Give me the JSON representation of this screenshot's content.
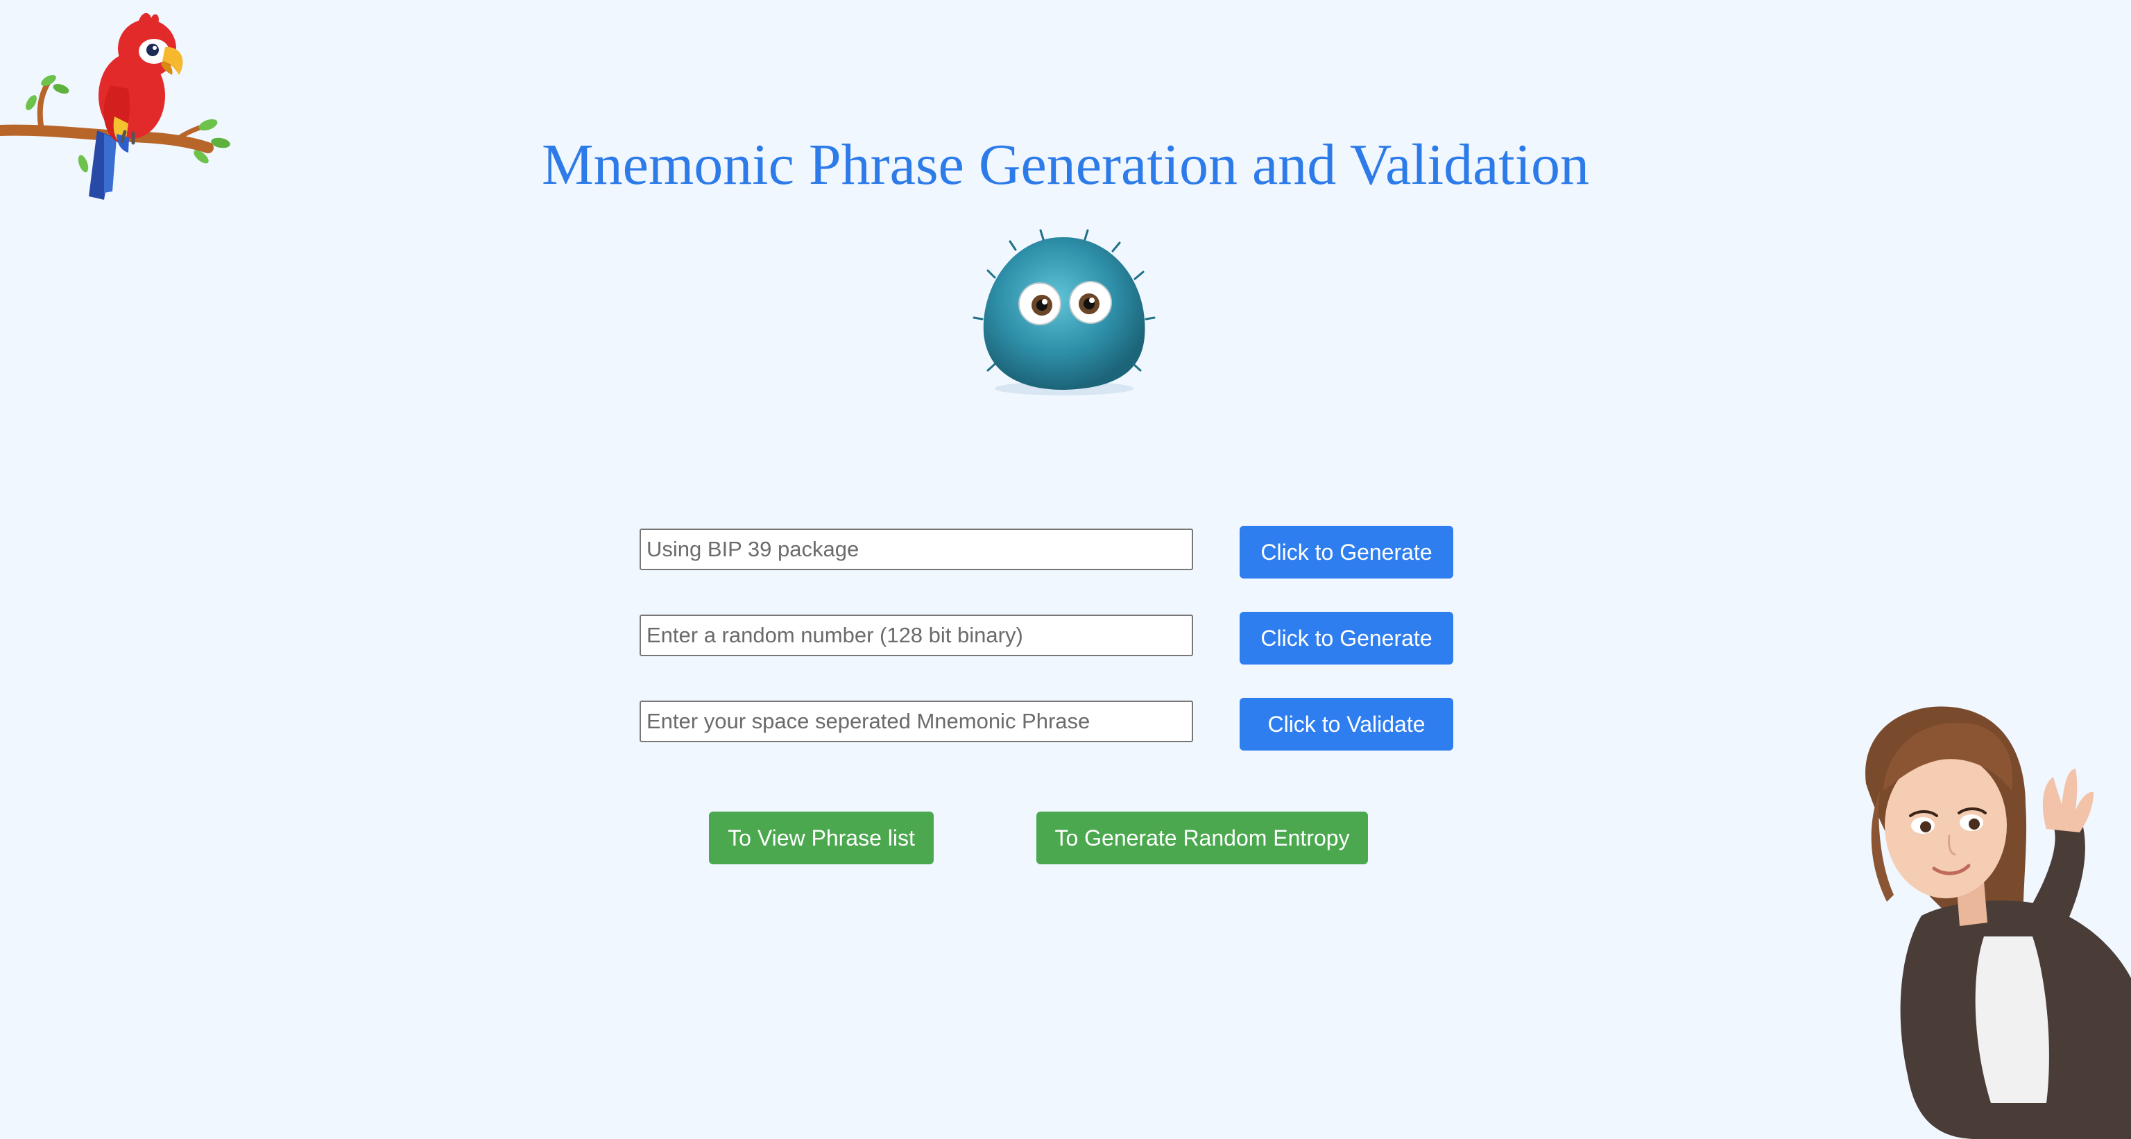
{
  "page": {
    "title": "Mnemonic Phrase Generation and Validation",
    "background_color": "#f0f7ff",
    "title_color": "#2d7be8"
  },
  "illustrations": {
    "parrot": "parrot-on-branch",
    "monster": "fluffy-blue-monster",
    "lady": "waving-cartoon-woman"
  },
  "form": {
    "rows": [
      {
        "input_value": "",
        "input_placeholder": "Using BIP 39 package",
        "button_label": "Click to Generate"
      },
      {
        "input_value": "",
        "input_placeholder": "Enter a random number (128 bit binary)",
        "button_label": "Click to Generate"
      },
      {
        "input_value": "",
        "input_placeholder": "Enter your space seperated Mnemonic Phrase",
        "button_label": "Click to Validate"
      }
    ],
    "primary_color": "#2f7ef0"
  },
  "actions": {
    "view_phrase_list_label": "To View Phrase list",
    "generate_entropy_label": "To Generate Random Entropy",
    "secondary_color": "#4ba84f"
  }
}
